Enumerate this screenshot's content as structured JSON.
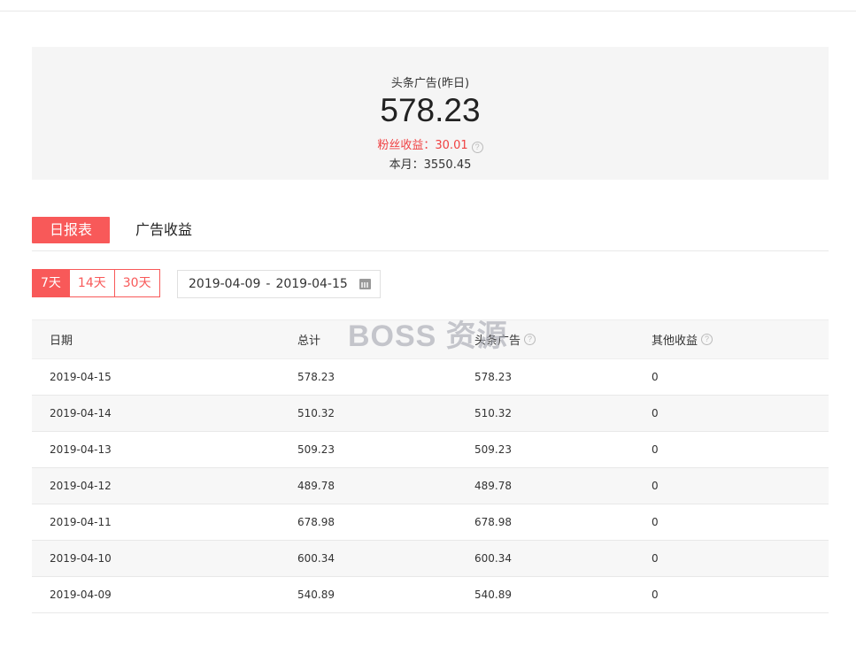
{
  "summary": {
    "label": "头条广告(昨日)",
    "amount": "578.23",
    "fans_income": "粉丝收益：30.01",
    "month": "本月：3550.45",
    "help_icon": "question-circle-icon"
  },
  "tabs": {
    "active": "日报表",
    "other": "广告收益"
  },
  "range": {
    "d7": "7天",
    "d14": "14天",
    "d30": "30天"
  },
  "date_range": {
    "start": "2019-04-09",
    "separator": "-",
    "end": "2019-04-15",
    "icon": "calendar-icon"
  },
  "watermark": "BOSS 资源",
  "table": {
    "headers": [
      "日期",
      "总计",
      "头条广告",
      "其他收益"
    ],
    "rows": [
      [
        "2019-04-15",
        "578.23",
        "578.23",
        "0"
      ],
      [
        "2019-04-14",
        "510.32",
        "510.32",
        "0"
      ],
      [
        "2019-04-13",
        "509.23",
        "509.23",
        "0"
      ],
      [
        "2019-04-12",
        "489.78",
        "489.78",
        "0"
      ],
      [
        "2019-04-11",
        "678.98",
        "678.98",
        "0"
      ],
      [
        "2019-04-10",
        "600.34",
        "600.34",
        "0"
      ],
      [
        "2019-04-09",
        "540.89",
        "540.89",
        "0"
      ]
    ]
  },
  "colors": {
    "accent": "#f85959",
    "fans": "#f04142",
    "panel": "#f5f5f5"
  }
}
